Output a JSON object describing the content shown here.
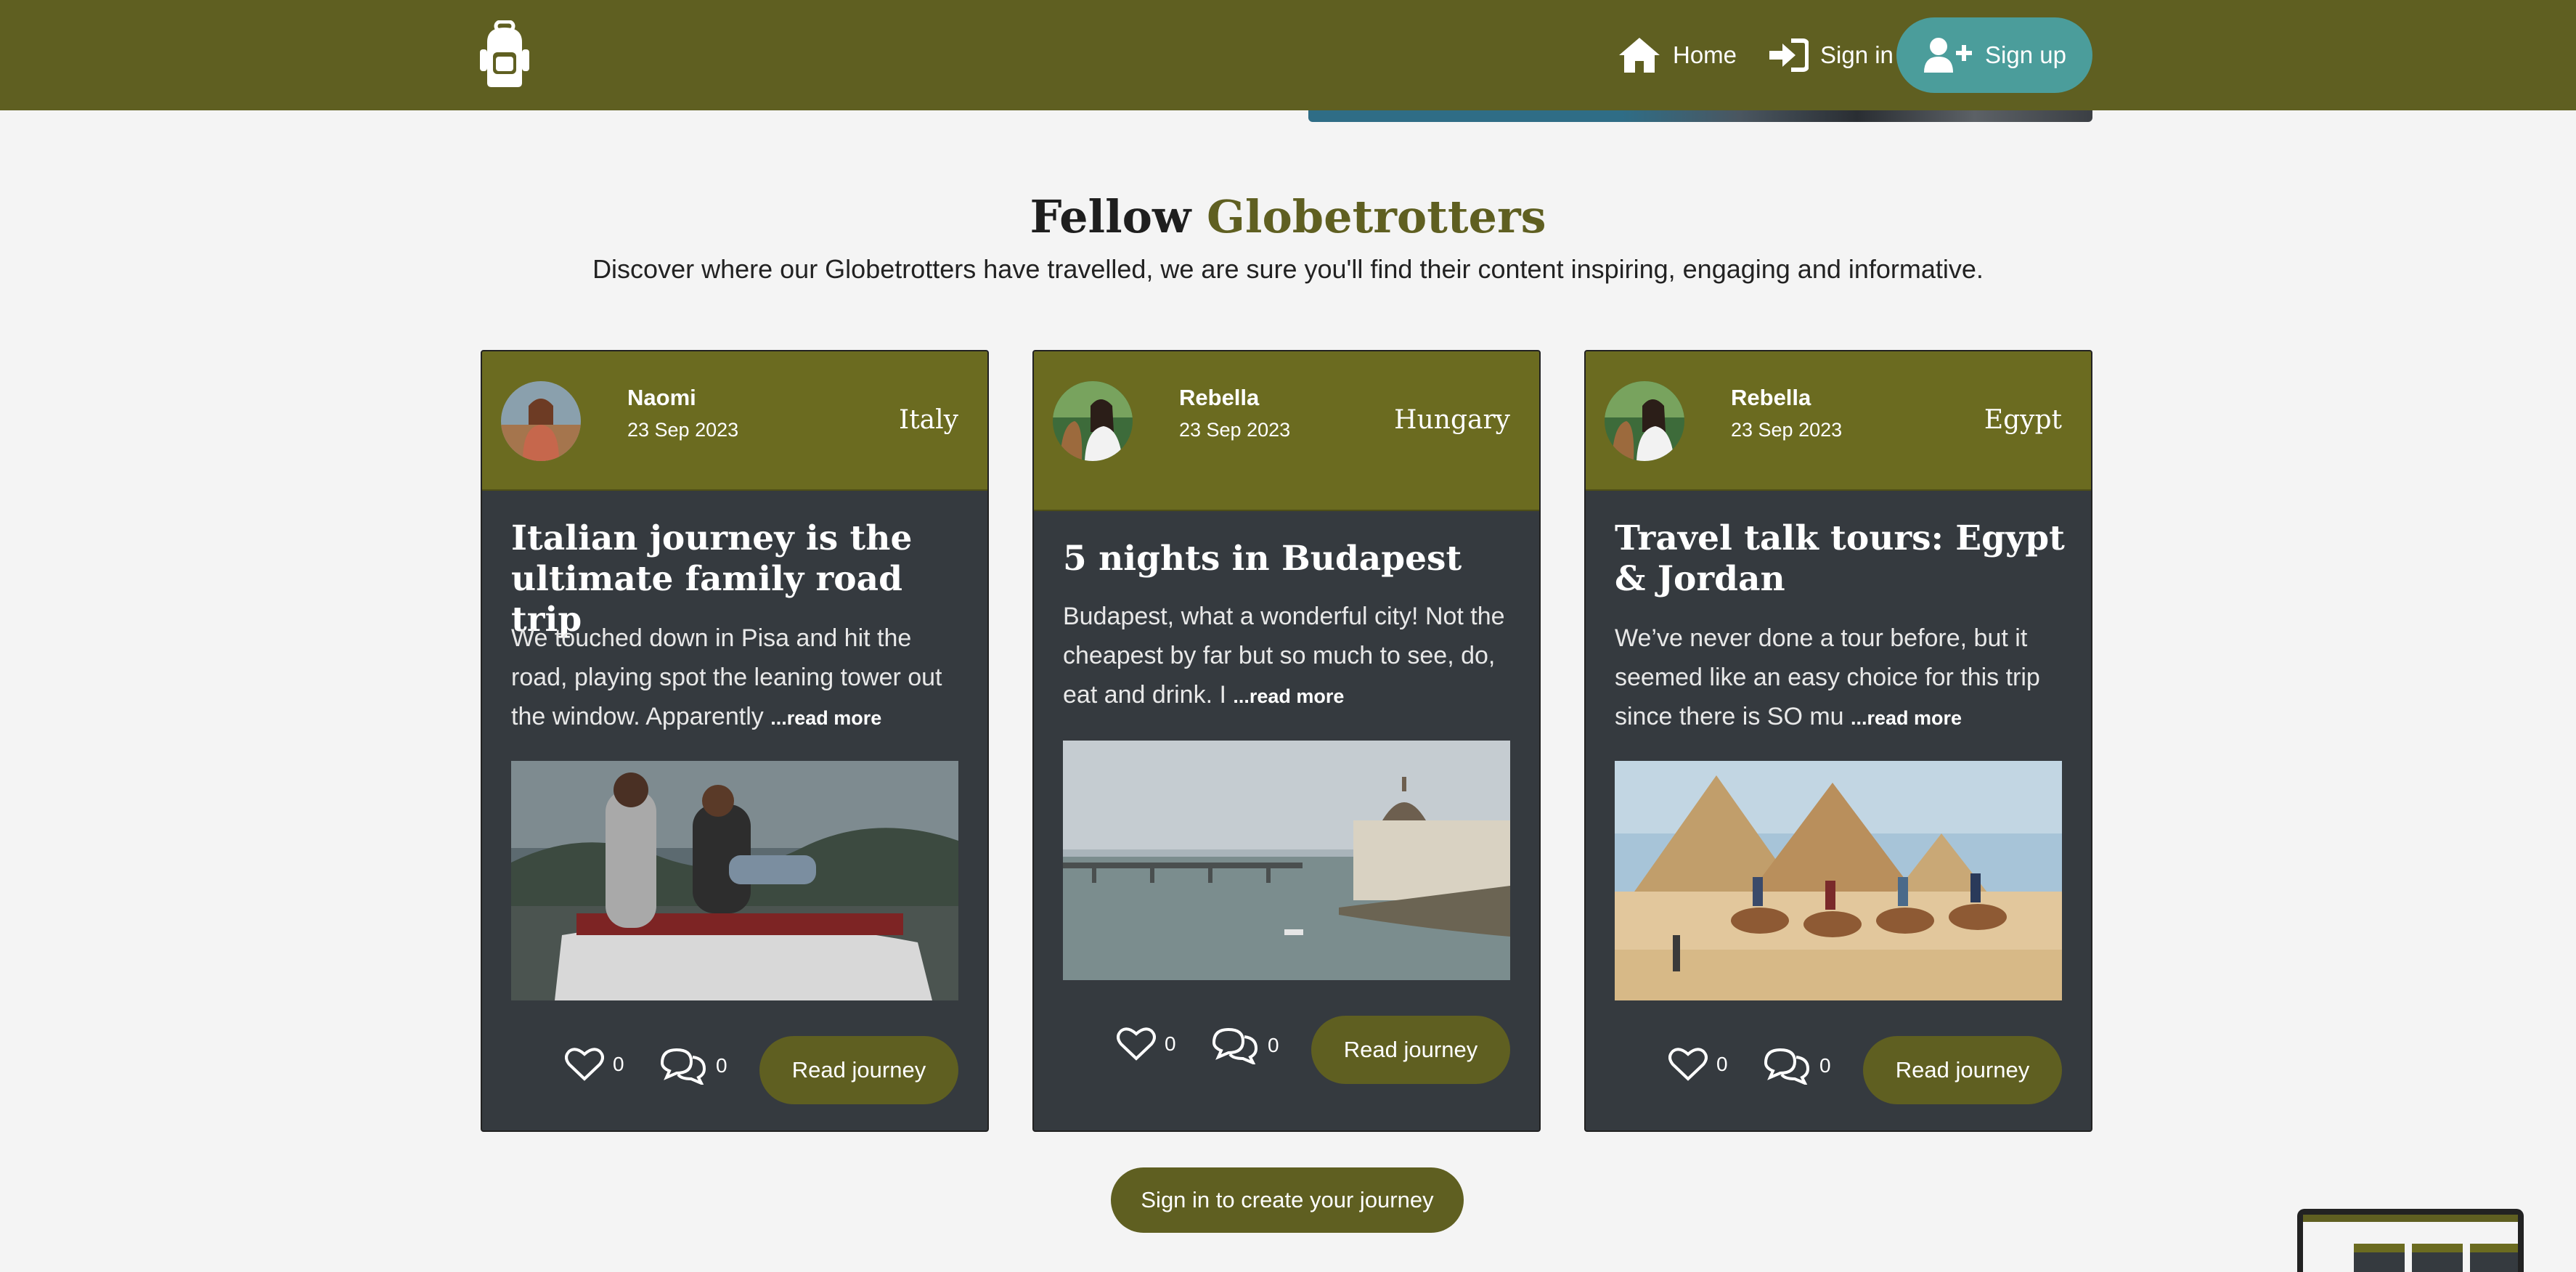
{
  "nav": {
    "logo_icon": "backpack-icon",
    "home_label": "Home",
    "signin_label": "Sign in",
    "signup_label": "Sign up",
    "colors": {
      "bar": "#5f5f21",
      "signup": "#4b9d9b"
    }
  },
  "section": {
    "title_main": "Fellow",
    "title_accent": "Globetrotters",
    "subtitle": "Discover where our Globetrotters have travelled, we are sure you'll find their content inspiring, engaging and informative."
  },
  "cards": [
    {
      "author": "Naomi",
      "date": "23 Sep 2023",
      "country": "Italy",
      "title": "Italian journey is the ultimate family road trip",
      "excerpt": "We touched down in Pisa and hit the road, playing spot the leaning tower out the window. Apparently ",
      "read_more": "...read more",
      "likes": "0",
      "comments": "0",
      "button": "Read journey"
    },
    {
      "author": "Rebella",
      "date": "23 Sep 2023",
      "country": "Hungary",
      "title": "5 nights in Budapest",
      "excerpt": "Budapest, what a wonderful city! Not the cheapest by far but so much to see, do, eat and drink. I ",
      "read_more": "...read more",
      "likes": "0",
      "comments": "0",
      "button": "Read journey"
    },
    {
      "author": "Rebella",
      "date": "23 Sep 2023",
      "country": "Egypt",
      "title": "Travel talk tours: Egypt & Jordan",
      "excerpt": "We’ve never done a tour before, but it seemed like an easy choice for this trip since there is SO mu ",
      "read_more": "...read more",
      "likes": "0",
      "comments": "0",
      "button": "Read journey"
    }
  ],
  "cta_label": "Sign in to create your journey"
}
